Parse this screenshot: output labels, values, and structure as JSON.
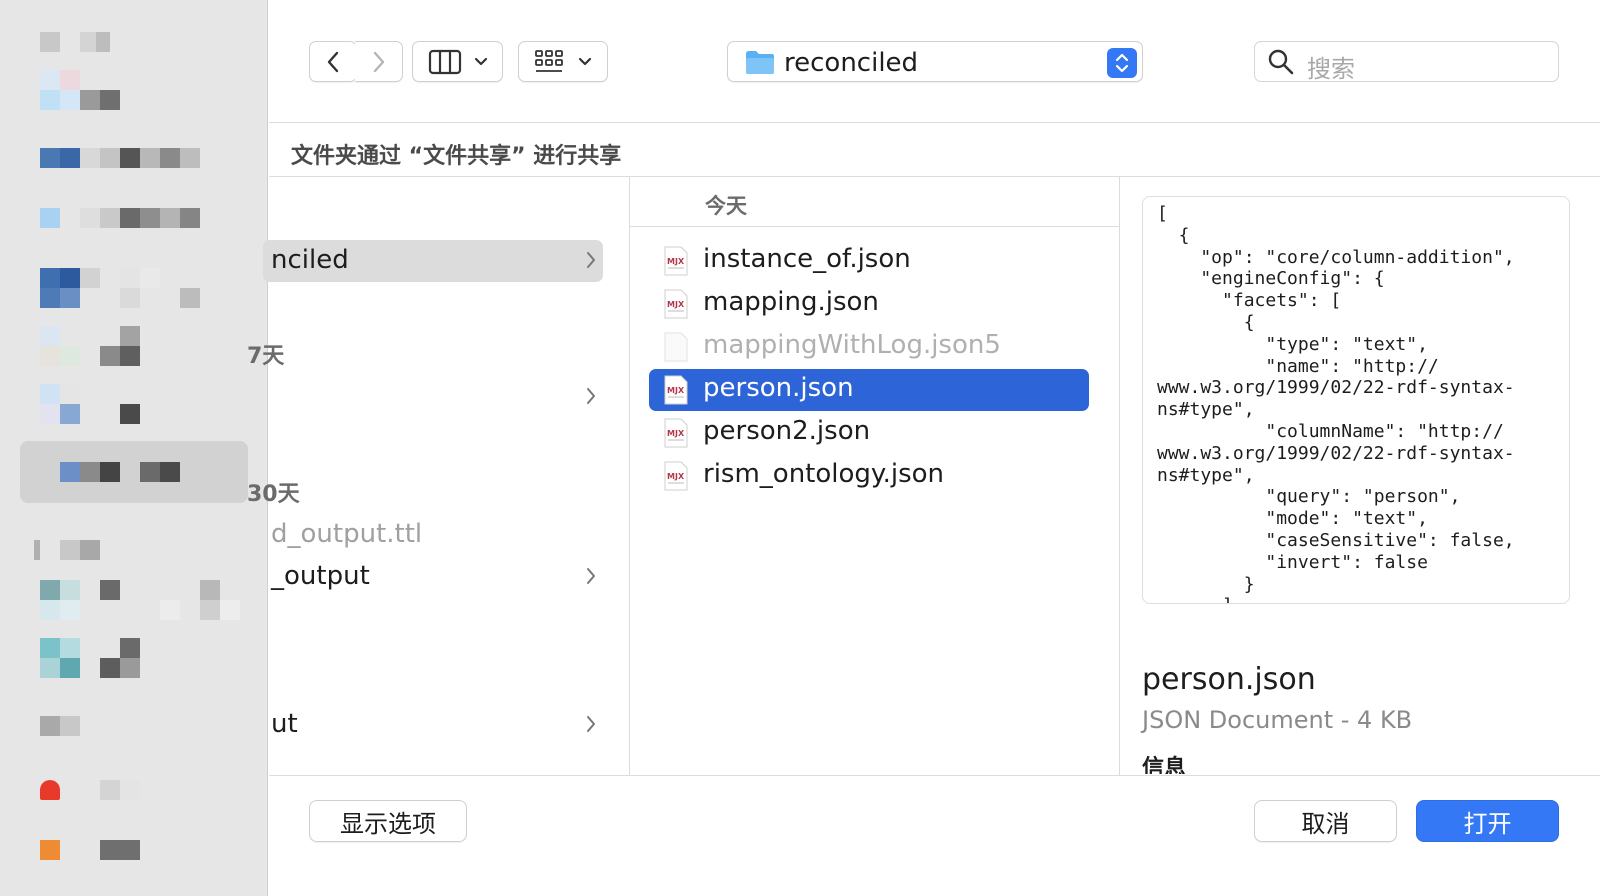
{
  "toolbar": {
    "back_icon": "chevron-left-icon",
    "forward_icon": "chevron-right-icon",
    "view_icon": "column-view-icon",
    "group_icon": "grid-icon",
    "path_label": "reconciled",
    "search_placeholder": "搜索"
  },
  "share_note": "文件夹通过 “文件共享” 进行共享",
  "column1": {
    "rows": [
      {
        "label": "nciled",
        "chevron": true
      },
      {
        "label": "",
        "chevron": true
      },
      {
        "label": "d_output.ttl",
        "chevron": false
      },
      {
        "label": "_output",
        "chevron": true
      },
      {
        "label": "ut",
        "chevron": true
      }
    ],
    "groups": [
      "7天",
      "30天"
    ]
  },
  "column2": {
    "header": "今天",
    "files": [
      {
        "name": "instance_of.json",
        "state": "normal"
      },
      {
        "name": "mapping.json",
        "state": "normal"
      },
      {
        "name": "mappingWithLog.json5",
        "state": "disabled"
      },
      {
        "name": "person.json",
        "state": "selected"
      },
      {
        "name": "person2.json",
        "state": "normal"
      },
      {
        "name": "rism_ontology.json",
        "state": "normal"
      }
    ]
  },
  "preview": {
    "content": "[\n  {\n    \"op\": \"core/column-addition\",\n    \"engineConfig\": {\n      \"facets\": [\n        {\n          \"type\": \"text\",\n          \"name\": \"http://\nwww.w3.org/1999/02/22-rdf-syntax-\nns#type\",\n          \"columnName\": \"http://\nwww.w3.org/1999/02/22-rdf-syntax-\nns#type\",\n          \"query\": \"person\",\n          \"mode\": \"text\",\n          \"caseSensitive\": false,\n          \"invert\": false\n        }\n      ]",
    "filename": "person.json",
    "kind": "JSON Document - 4 KB",
    "info_label": "信息"
  },
  "buttons": {
    "options": "显示选项",
    "cancel": "取消",
    "open": "打开"
  },
  "colors": {
    "accent": "#3478f6",
    "selection": "#2d64d8"
  }
}
